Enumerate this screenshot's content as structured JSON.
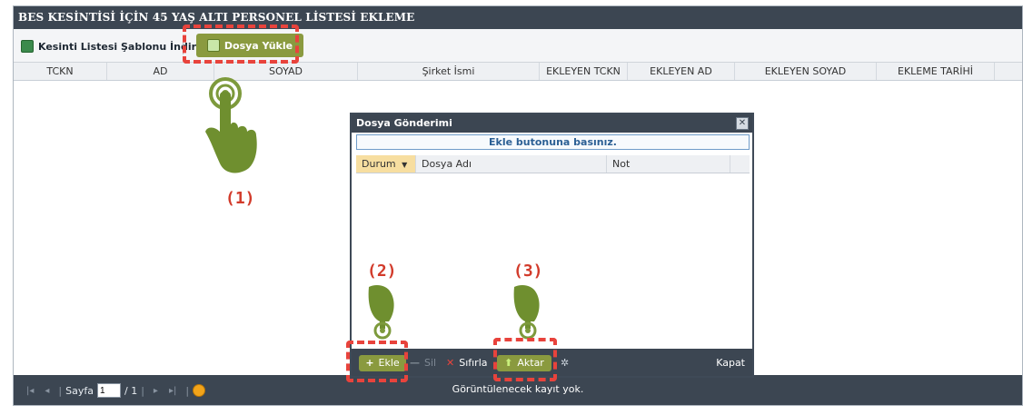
{
  "window": {
    "title": "BES KESİNTİSİ İÇİN 45 YAŞ ALTI PERSONEL LİSTESİ EKLEME"
  },
  "toolbar": {
    "download_template_label": "Kesinti Listesi Şablonu İndir",
    "upload_label": "Dosya Yükle"
  },
  "grid": {
    "columns": [
      "TCKN",
      "AD",
      "SOYAD",
      "Şirket İsmi",
      "EKLEYEN TCKN",
      "EKLEYEN AD",
      "EKLEYEN SOYAD",
      "EKLEME TARİHİ"
    ]
  },
  "pager": {
    "page_label": "Sayfa",
    "page_value": "1",
    "page_total": "/ 1",
    "empty_text": "Görüntülenecek kayıt yok."
  },
  "dialog": {
    "title": "Dosya Gönderimi",
    "hint": "Ekle butonuna basınız.",
    "columns": [
      "Durum",
      "Dosya Adı",
      "Not"
    ],
    "buttons": {
      "add": "Ekle",
      "delete": "Sil",
      "reset": "Sıfırla",
      "transfer": "Aktar",
      "close": "Kapat"
    }
  },
  "annotations": {
    "step1": "(1)",
    "step2": "(2)",
    "step3": "(3)"
  },
  "colors": {
    "header_dark": "#3c4652",
    "upload_green": "#8a9a3f",
    "highlight_red": "#e8433c",
    "hint_blue": "#2b5f94"
  },
  "icons": [
    "spreadsheet-icon",
    "upload-icon",
    "pointing-hand-icon",
    "plus-icon",
    "minus-icon",
    "x-icon",
    "up-arrow-icon",
    "spinner-icon",
    "first-page-icon",
    "prev-page-icon",
    "next-page-icon",
    "last-page-icon",
    "refresh-icon",
    "close-icon",
    "sort-down-icon"
  ]
}
